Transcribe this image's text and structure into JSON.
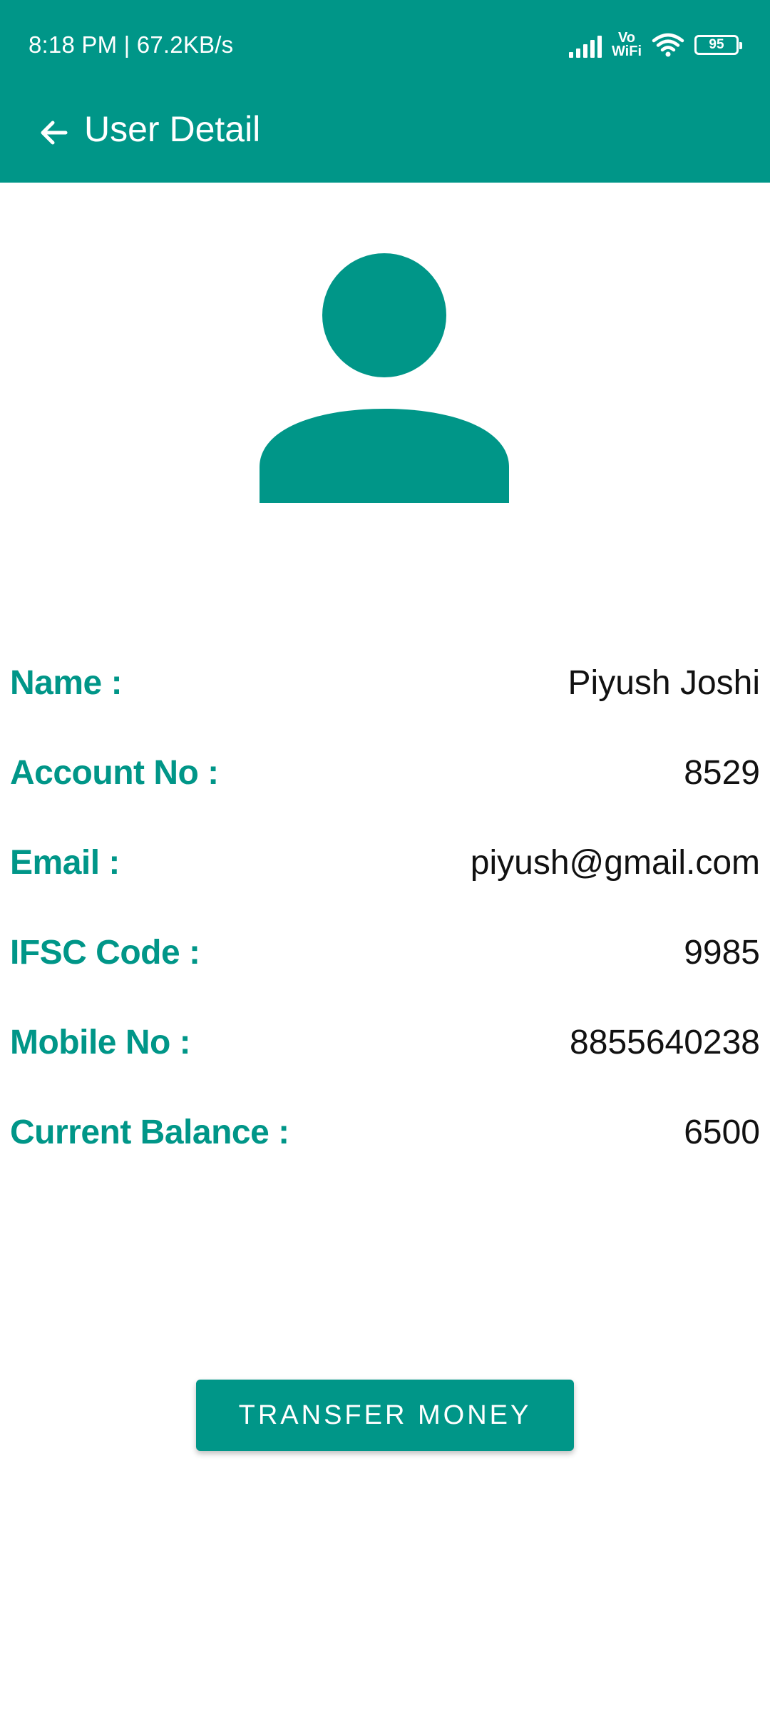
{
  "status_bar": {
    "time_speed": "8:18 PM | 67.2KB/s",
    "vowifi_line1": "Vo",
    "vowifi_line2": "WiFi",
    "battery_level": "95",
    "icons": [
      "signal-icon",
      "vowifi-icon",
      "wifi-icon",
      "battery-icon"
    ]
  },
  "toolbar": {
    "back_icon": "arrow-left-icon",
    "title": "User Detail"
  },
  "avatar": {
    "icon": "person-icon",
    "color": "#009688"
  },
  "details": [
    {
      "label": "Name :",
      "value": "Piyush Joshi"
    },
    {
      "label": "Account No :",
      "value": "8529"
    },
    {
      "label": "Email :",
      "value": "piyush@gmail.com"
    },
    {
      "label": "IFSC Code :",
      "value": "9985"
    },
    {
      "label": "Mobile No :",
      "value": "8855640238"
    },
    {
      "label": "Current Balance :",
      "value": "6500"
    }
  ],
  "transfer_button": {
    "label": "TRANSFER MONEY"
  },
  "colors": {
    "primary": "#009688",
    "background": "#ffffff",
    "text": "#111111"
  }
}
